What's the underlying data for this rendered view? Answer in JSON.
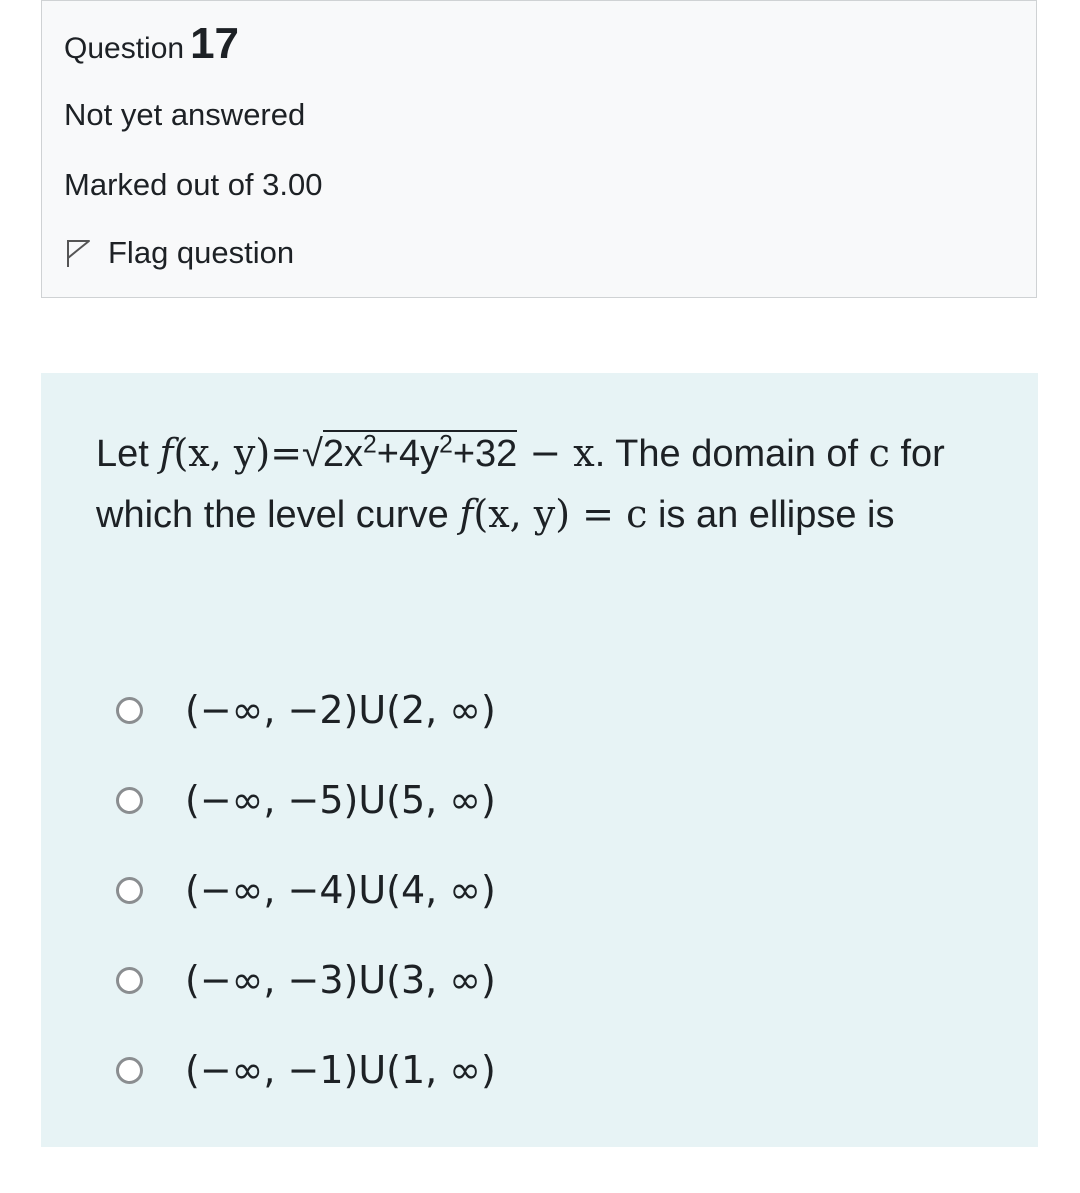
{
  "question_info": {
    "question_word": "Question",
    "question_number": "17",
    "state": "Not yet answered",
    "grade": "Marked out of 3.00",
    "flag_label": "Flag question",
    "flag_icon": "flag-outline-icon"
  },
  "question_text": {
    "intro": "Let ",
    "f": "f",
    "args": "(x, y)",
    "equals": "=",
    "radicand_a": "2x",
    "sup_a": "2",
    "radicand_b": "+4y",
    "sup_b": "2",
    "radicand_c": "+32",
    "minus_x": " − x",
    "after_formula": ". The domain of ",
    "c1": "c",
    "middle": " for which the level curve ",
    "f2": "f",
    "args2": "(x, y)",
    "equals2": " = ",
    "c2": "c",
    "ending": " is an ellipse is"
  },
  "answers": [
    {
      "label": "(−∞, −2)U(2, ∞)"
    },
    {
      "label": "(−∞, −5)U(5, ∞)"
    },
    {
      "label": "(−∞, −4)U(4, ∞)"
    },
    {
      "label": "(−∞, −3)U(3, ∞)"
    },
    {
      "label": "(−∞, −1)U(1, ∞)"
    }
  ],
  "colors": {
    "info_background": "#f8f9fa",
    "content_background": "#e7f3f5",
    "text": "#1d2125",
    "radio_border": "#8a8d90"
  }
}
